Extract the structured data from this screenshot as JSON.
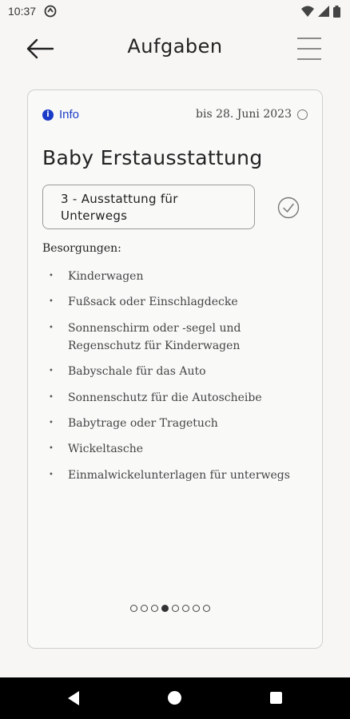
{
  "status_bar": {
    "time": "10:37",
    "icons": [
      "app-notification-icon",
      "wifi-icon",
      "signal-icon",
      "battery-icon"
    ]
  },
  "app_bar": {
    "title": "Aufgaben",
    "back_icon": "arrow-left-icon",
    "menu_icon": "hamburger-menu-icon"
  },
  "card": {
    "info_label": "Info",
    "due_date": "bis 28. Juni 2023",
    "title": "Baby Erstausstattung",
    "category_line1": "3 - Ausstattung für",
    "category_line2": "Unterwegs",
    "section_label": "Besorgungen:",
    "items": [
      "Kinderwagen",
      "Fußsack oder Einschlagdecke",
      "Sonnenschirm oder -segel und Regenschutz für Kinderwagen",
      "Babyschale für das Auto",
      "Sonnenschutz für die Autoscheibe",
      "Babytrage oder Tragetuch",
      "Wickeltasche",
      "Einmalwickelunterlagen für unterwegs"
    ],
    "pager": {
      "total": 8,
      "active_index": 3
    }
  },
  "colors": {
    "accent": "#1a3cc8",
    "background": "#f7f6f4",
    "nav_bar": "#000000"
  }
}
